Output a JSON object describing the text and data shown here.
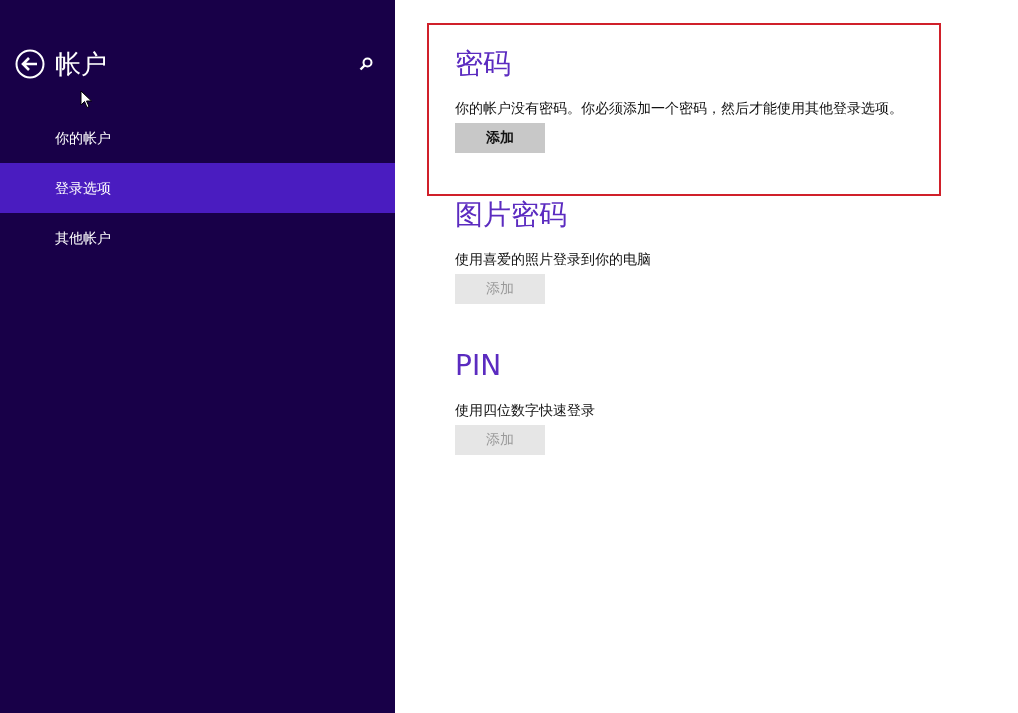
{
  "sidebar": {
    "title": "帐户",
    "items": [
      {
        "label": "你的帐户",
        "selected": false
      },
      {
        "label": "登录选项",
        "selected": true
      },
      {
        "label": "其他帐户",
        "selected": false
      }
    ]
  },
  "sections": [
    {
      "title": "密码",
      "description": "你的帐户没有密码。你必须添加一个密码，然后才能使用其他登录选项。",
      "button": {
        "label": "添加",
        "disabled": false
      },
      "highlighted": true
    },
    {
      "title": "图片密码",
      "description": "使用喜爱的照片登录到你的电脑",
      "button": {
        "label": "添加",
        "disabled": true
      },
      "highlighted": false
    },
    {
      "title": "PIN",
      "description": "使用四位数字快速登录",
      "button": {
        "label": "添加",
        "disabled": true
      },
      "highlighted": false
    }
  ]
}
